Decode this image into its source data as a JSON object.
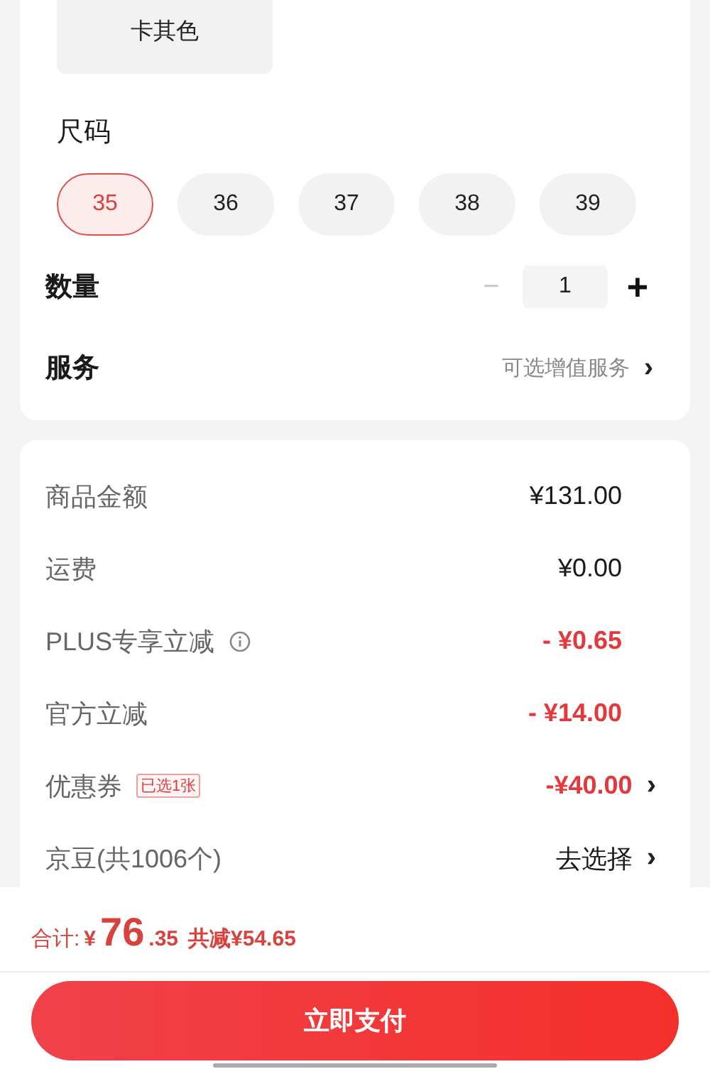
{
  "color_option": {
    "label": "卡其色"
  },
  "size": {
    "title": "尺码",
    "options": [
      {
        "label": "35",
        "selected": true
      },
      {
        "label": "36",
        "selected": false
      },
      {
        "label": "37",
        "selected": false
      },
      {
        "label": "38",
        "selected": false
      },
      {
        "label": "39",
        "selected": false
      }
    ]
  },
  "quantity": {
    "label": "数量",
    "minus": "−",
    "value": "1",
    "plus": "+",
    "minus_disabled": true
  },
  "service": {
    "label": "服务",
    "value": "可选增值服务",
    "chevron": "›"
  },
  "summary": [
    {
      "label": "商品金额",
      "value": "¥131.00",
      "kind": "plain",
      "info": false
    },
    {
      "label": "运费",
      "value": "¥0.00",
      "kind": "plain",
      "info": false
    },
    {
      "label": "PLUS专享立减",
      "value": "- ¥0.65",
      "kind": "discount",
      "info": true
    },
    {
      "label": "官方立减",
      "value": "- ¥14.00",
      "kind": "discount",
      "info": false
    },
    {
      "label": "优惠券",
      "tag": "已选1张",
      "value": "-¥40.00",
      "kind": "discount",
      "info": false,
      "chevron": "›"
    },
    {
      "label": "京豆(共1006个)",
      "value": "去选择",
      "kind": "plain",
      "info": false,
      "chevron": "›"
    }
  ],
  "total": {
    "label": "合计:",
    "currency": "¥",
    "integer": "76",
    "decimal": ".35",
    "saved": "共减¥54.65"
  },
  "pay_button": {
    "label": "立即支付"
  }
}
